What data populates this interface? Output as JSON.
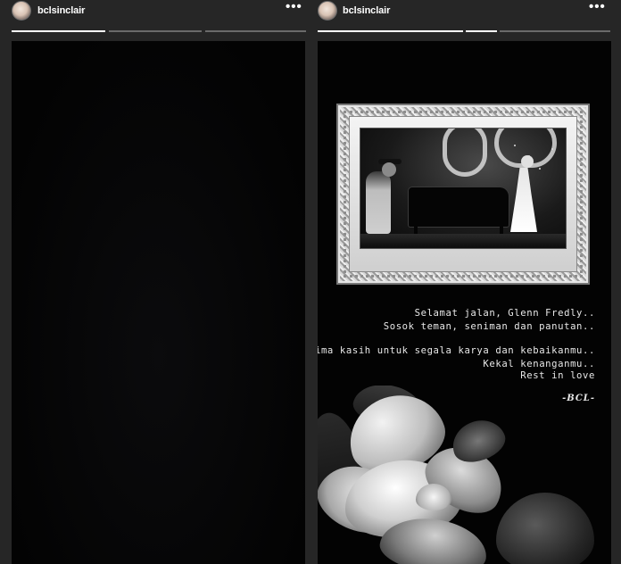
{
  "left_story": {
    "username": "bclsinclair",
    "separator": "·",
    "more_icon": "more-horizontal-icon",
    "progress": [
      1.0,
      0.0,
      0.0
    ]
  },
  "right_story": {
    "username": "bclsinclair",
    "more_icon": "more-horizontal-icon",
    "progress": [
      1.0,
      1.0,
      0.0
    ],
    "memorial": {
      "line1": "Selamat jalan, Glenn Fredly..",
      "line2": "Sosok teman, seniman dan panutan..",
      "line3": "Terima kasih untuk segala karya dan kebaikanmu..",
      "line4": "Kekal kenanganmu..",
      "line5": "Rest in love",
      "signature": "-BCL-"
    }
  },
  "colors": {
    "background": "#262626",
    "progress_track": "#6a6a6a",
    "progress_fill": "#ffffff"
  }
}
